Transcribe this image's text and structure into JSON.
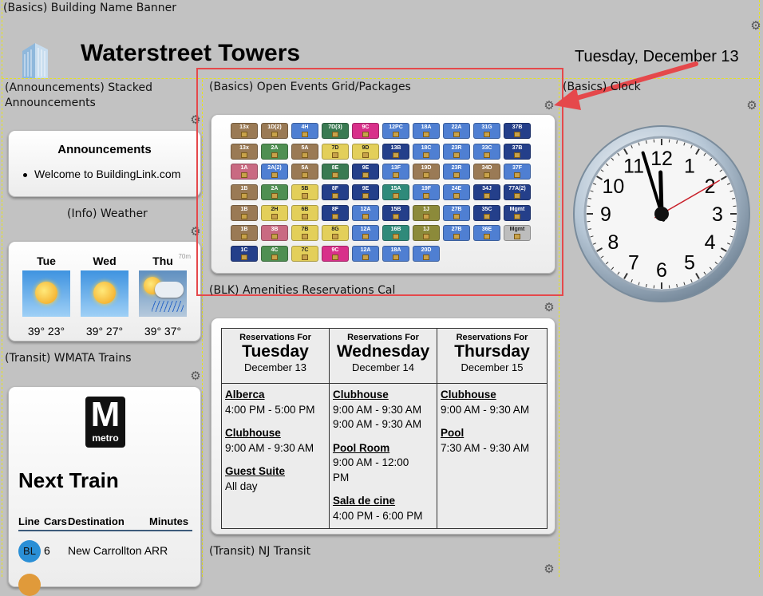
{
  "zones": {
    "banner": "(Basics) Building Name Banner",
    "announcements": "(Announcements) Stacked Announcements",
    "packages": "(Basics) Open Events Grid/Packages",
    "clock": "(Basics) Clock",
    "weather": "(Info) Weather",
    "amenities": "(BLK) Amenities Reservations Cal",
    "wmata": "(Transit) WMATA Trains",
    "nj": "(Transit) NJ Transit"
  },
  "header": {
    "building_name": "Waterstreet Towers",
    "date": "Tuesday, December 13"
  },
  "announcements": {
    "title": "Announcements",
    "items": [
      "Welcome to BuildingLink.com"
    ]
  },
  "weather": {
    "tag": "70m",
    "days": [
      {
        "day": "Tue",
        "temps": "39° 23°",
        "icon": "sun-icon"
      },
      {
        "day": "Wed",
        "temps": "39° 27°",
        "icon": "sun-icon"
      },
      {
        "day": "Thu",
        "temps": "39° 37°",
        "icon": "rain-icon"
      }
    ]
  },
  "packages": [
    [
      "13x",
      "1D(2)",
      "4H",
      "7D(3)",
      "9C",
      "12PC",
      "18A",
      "22A",
      "31G",
      "37B"
    ],
    [
      "13x",
      "2A",
      "5A",
      "7D",
      "9D",
      "13B",
      "18C",
      "23R",
      "33C",
      "37B"
    ],
    [
      "1A",
      "2A(2)",
      "5A",
      "8E",
      "9E",
      "13F",
      "19D",
      "23R",
      "34D",
      "37F"
    ],
    [
      "1B",
      "2A",
      "5B",
      "8F",
      "9E",
      "15A",
      "19F",
      "24E",
      "34J",
      "77A(2)"
    ],
    [
      "1B",
      "2H",
      "6B",
      "8F",
      "12A",
      "15B",
      "1J",
      "27B",
      "35C",
      "Mgmt"
    ],
    [
      "1B",
      "3B",
      "7B",
      "8G",
      "12A",
      "16B",
      "1J",
      "27B",
      "36E",
      "Mgmt"
    ],
    [
      "1C",
      "4C",
      "7C",
      "9C",
      "12A",
      "18A",
      "20D"
    ]
  ],
  "package_colors": {
    "tan": "#9a7a55",
    "blue": "#4f7fd2",
    "navy": "#243f8a",
    "green": "#4f8f52",
    "yellow": "#e3cf5a",
    "pink": "#d8308a",
    "rose": "#c96a82",
    "teal": "#2f8a7a",
    "olive": "#8c8a3a",
    "gray": "#bdbdbd",
    "dkgreen": "#3a7a52"
  },
  "reservations": [
    {
      "label": "Reservations For",
      "day": "Tuesday",
      "date": "December 13",
      "entries": [
        {
          "place": "Alberca",
          "times": [
            "4:00 PM - 5:00 PM"
          ]
        },
        {
          "place": "Clubhouse",
          "times": [
            "9:00 AM - 9:30 AM"
          ]
        },
        {
          "place": "Guest Suite",
          "times": [
            "All day"
          ]
        }
      ]
    },
    {
      "label": "Reservations For",
      "day": "Wednesday",
      "date": "December 14",
      "entries": [
        {
          "place": "Clubhouse",
          "times": [
            "9:00 AM - 9:30 AM",
            "9:00 AM - 9:30 AM"
          ]
        },
        {
          "place": "Pool Room",
          "times": [
            "9:00 AM - 12:00",
            "PM"
          ]
        },
        {
          "place": "Sala de cine",
          "times": [
            "4:00 PM - 6:00 PM"
          ]
        }
      ]
    },
    {
      "label": "Reservations For",
      "day": "Thursday",
      "date": "December 15",
      "entries": [
        {
          "place": "Clubhouse",
          "times": [
            "9:00 AM - 9:30 AM"
          ]
        },
        {
          "place": "Pool",
          "times": [
            "7:30 AM - 9:30 AM"
          ]
        }
      ]
    }
  ],
  "trains": {
    "logo_letter": "M",
    "logo_word": "metro",
    "title": "Next Train",
    "columns": [
      "Line",
      "Cars",
      "Destination",
      "Minutes"
    ],
    "rows": [
      {
        "line": "BL",
        "cars": "6",
        "destination": "New Carrollton ARR",
        "minutes": "",
        "color": "#2a8fd6"
      }
    ]
  },
  "clock": {
    "numbers": [
      "12",
      "1",
      "2",
      "3",
      "4",
      "5",
      "6",
      "7",
      "8",
      "9",
      "10",
      "11"
    ],
    "hours": 11,
    "minutes": 57,
    "seconds": 10
  }
}
